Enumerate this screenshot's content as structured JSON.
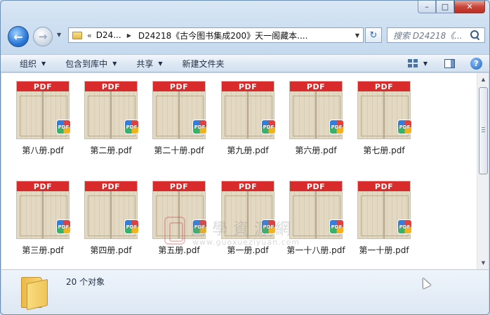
{
  "window": {
    "caption_buttons": {
      "minimize": "–",
      "maximize": "□",
      "close": "✕"
    }
  },
  "nav": {
    "back_icon": "back-arrow-icon",
    "forward_icon": "forward-arrow-icon"
  },
  "address": {
    "chevron": "«",
    "segments": [
      "D24...",
      "D24218《古今图书集成200》天一阁藏本...."
    ]
  },
  "search": {
    "placeholder": "搜索 D24218《..."
  },
  "toolbar": {
    "organize": "组织",
    "include_in_library": "包含到库中",
    "share": "共享",
    "new_folder": "新建文件夹"
  },
  "files": {
    "thumb_band": "PDF",
    "badge": "PDF",
    "items": [
      {
        "name": "第八册.pdf"
      },
      {
        "name": "第二册.pdf"
      },
      {
        "name": "第二十册.pdf"
      },
      {
        "name": "第九册.pdf"
      },
      {
        "name": "第六册.pdf"
      },
      {
        "name": "第七册.pdf"
      },
      {
        "name": "第三册.pdf"
      },
      {
        "name": "第四册.pdf"
      },
      {
        "name": "第五册.pdf"
      },
      {
        "name": "第一册.pdf"
      },
      {
        "name": "第一十八册.pdf"
      },
      {
        "name": "第一十册.pdf"
      }
    ]
  },
  "watermark": {
    "title": "國學資源網",
    "url": "www.guoxueziyuan.com"
  },
  "details": {
    "count_text": "20 个对象"
  },
  "colors": {
    "pdf_band": "#d92b2b",
    "window_chrome": "#c9dcef",
    "accent_blue": "#2a78d8"
  }
}
